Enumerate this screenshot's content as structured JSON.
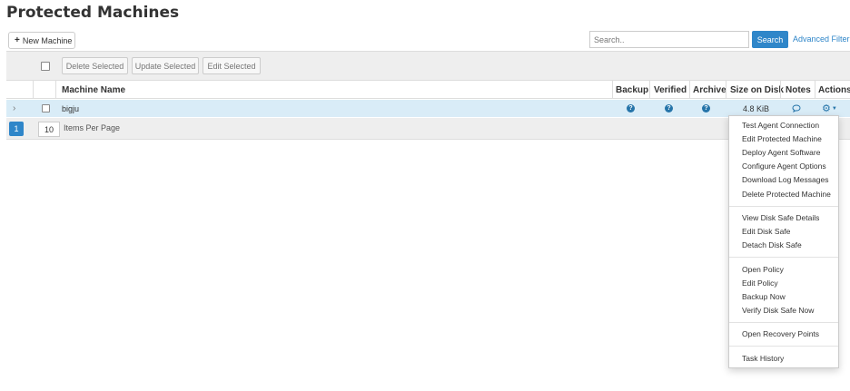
{
  "page": {
    "title": "Protected Machines"
  },
  "toolbar": {
    "new_machine_label": "New Machine",
    "search_placeholder": "Search..",
    "search_button": "Search",
    "advanced_filter": "Advanced Filter",
    "delete_selected": "Delete Selected",
    "update_selected": "Update Selected",
    "edit_selected": "Edit Selected"
  },
  "table": {
    "columns": [
      "Machine Name",
      "Backup",
      "Verified",
      "Archive",
      "Size on Disk",
      "Notes",
      "Actions"
    ],
    "rows": [
      {
        "machine_name": "bigju",
        "backup": "?",
        "verified": "?",
        "archive": "?",
        "size_on_disk": "4.8 KiB"
      }
    ]
  },
  "pagination": {
    "current_page": "1",
    "items_per_page": "10",
    "items_per_page_label": "Items Per Page"
  },
  "actions_menu": {
    "items": [
      "Test Agent Connection",
      "Edit Protected Machine",
      "Deploy Agent Software",
      "Configure Agent Options",
      "Download Log Messages",
      "Delete Protected Machine",
      "View Disk Safe Details",
      "Edit Disk Safe",
      "Detach Disk Safe",
      "Open Policy",
      "Edit Policy",
      "Backup Now",
      "Verify Disk Safe Now",
      "Open Recovery Points",
      "Task History"
    ]
  },
  "colors": {
    "accent": "#2f86c9",
    "row_selected": "#d9ecf7",
    "icon_blue": "#2574a9"
  }
}
